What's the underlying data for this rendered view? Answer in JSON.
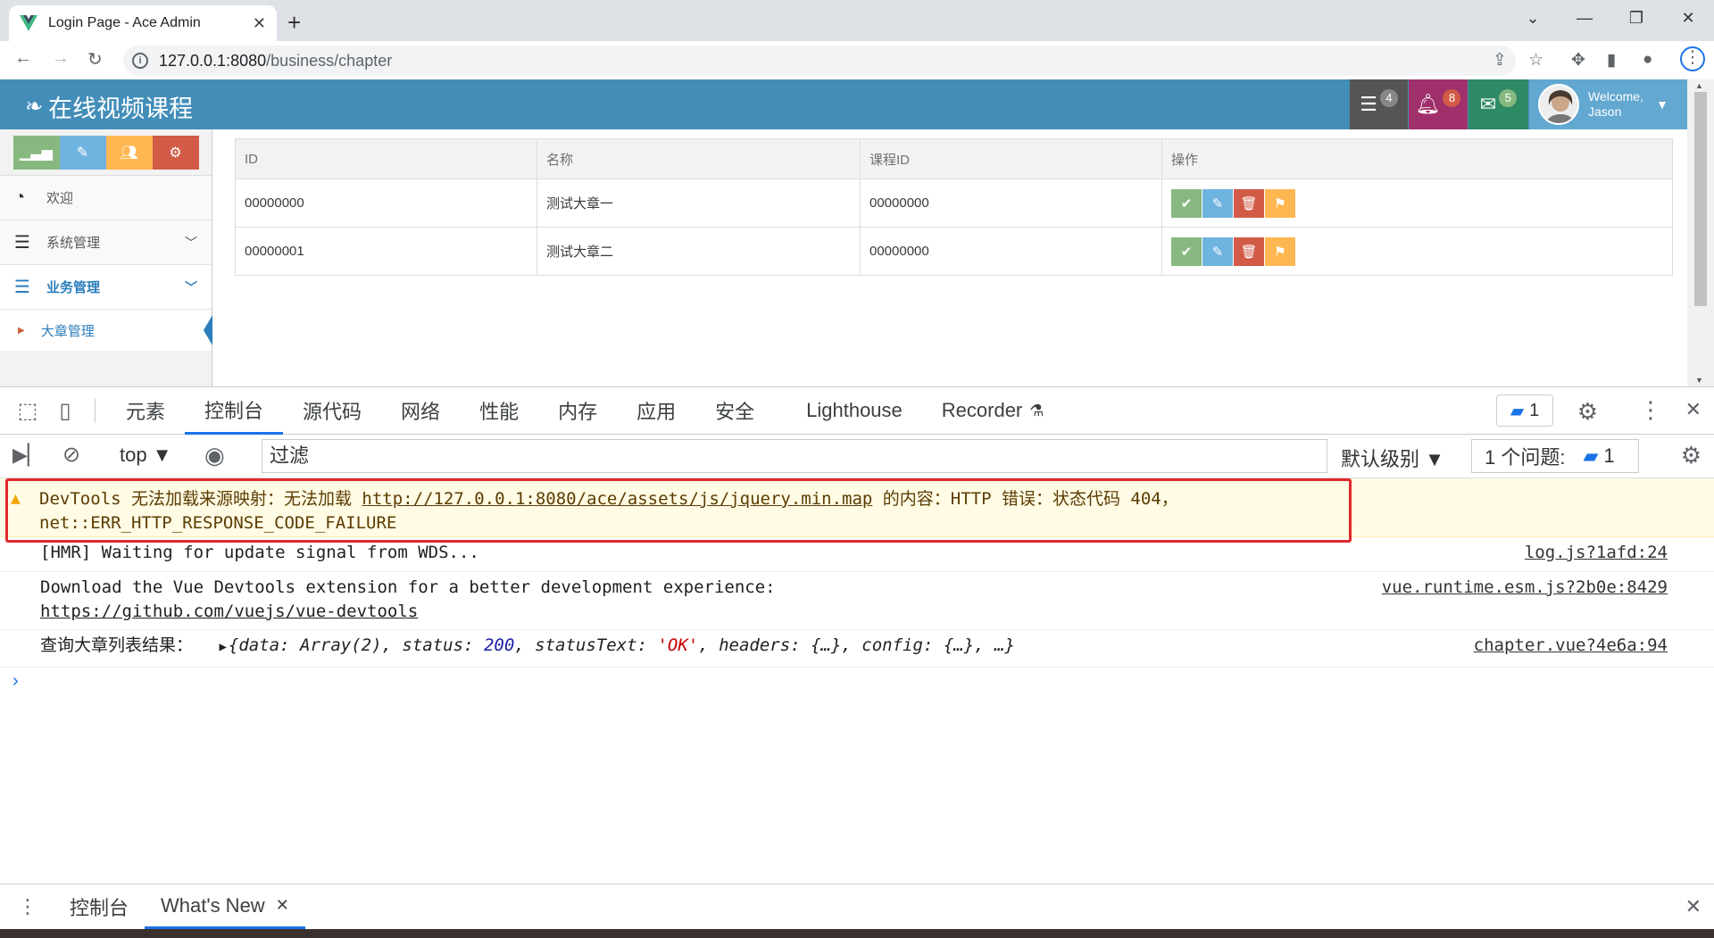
{
  "browser": {
    "tab_title": "Login Page - Ace Admin",
    "url_host": "127.0.0.1:8080",
    "url_path": "/business/chapter"
  },
  "navbar": {
    "brand": "在线视频课程",
    "tasks_count": "4",
    "notifications_count": "8",
    "messages_count": "5",
    "welcome": "Welcome,",
    "user": "Jason",
    "colors": {
      "bar": "#438eb9",
      "tasks": "#555555",
      "notifications": "#a0306b",
      "messages": "#2e8965",
      "user": "#62a8d1"
    }
  },
  "sidebar": {
    "items": [
      {
        "label": "欢迎",
        "icon": "dashboard-icon"
      },
      {
        "label": "系统管理",
        "icon": "list-icon"
      },
      {
        "label": "业务管理",
        "icon": "list-icon"
      }
    ],
    "sub_items": [
      {
        "label": "大章管理"
      }
    ]
  },
  "table": {
    "headers": [
      "ID",
      "名称",
      "课程ID",
      "操作"
    ],
    "rows": [
      {
        "id": "00000000",
        "name": "测试大章一",
        "course_id": "00000000"
      },
      {
        "id": "00000001",
        "name": "测试大章二",
        "course_id": "00000000"
      }
    ]
  },
  "devtools": {
    "tabs": [
      "元素",
      "控制台",
      "源代码",
      "网络",
      "性能",
      "内存",
      "应用",
      "安全",
      "Lighthouse",
      "Recorder"
    ],
    "issues_count": "1",
    "context": "top",
    "filter_placeholder": "过滤",
    "levels": "默认级别",
    "issues_label": "1 个问题:",
    "issues_label_count": "1"
  },
  "console": {
    "warning_line1_a": "DevTools 无法加载来源映射：无法加载 ",
    "warning_link": "http://127.0.0.1:8080/ace/assets/js/jquery.min.map",
    "warning_line1_b": " 的内容：HTTP 错误：状态代码 404，",
    "warning_line2": "net::ERR_HTTP_RESPONSE_CODE_FAILURE",
    "line1": "[HMR] Waiting for update signal from WDS...",
    "line1_src": "log.js?1afd:24",
    "line2a": "Download the Vue Devtools extension for a better development experience:",
    "line2b": "https://github.com/vuejs/vue-devtools",
    "line2_src": "vue.runtime.esm.js?2b0e:8429",
    "line3_label": "查询大章列表结果：",
    "line3_obj": {
      "k1": "data",
      "v1": "Array(2)",
      "k2": "status",
      "v2": "200",
      "k3": "statusText",
      "v3": "'OK'",
      "k4": "headers",
      "v4": "{…}",
      "k5": "config",
      "v5": "{…}",
      "tail": "…"
    },
    "line3_src": "chapter.vue?4e6a:94"
  },
  "drawer": {
    "tab1": "控制台",
    "tab2": "What's New"
  }
}
